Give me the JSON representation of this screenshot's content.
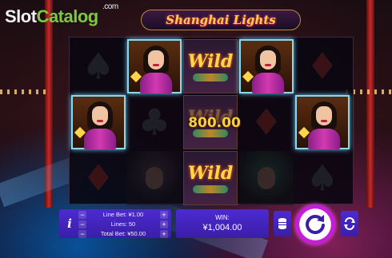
{
  "watermark": {
    "part1": "Slot",
    "part2": "Catalog",
    "suffix": ".com"
  },
  "game": {
    "title": "Shanghai Lights"
  },
  "reels": {
    "wild_label": "Wild",
    "win_on_reel": "800.00",
    "symbols": [
      [
        "spade",
        "lady",
        "diamond"
      ],
      [
        "lady",
        "club",
        "man"
      ],
      [
        "wild",
        "wild",
        "wild"
      ],
      [
        "lady",
        "diamond",
        "woman"
      ],
      [
        "diamond",
        "lady",
        "spade"
      ]
    ]
  },
  "controls": {
    "info_icon": "i",
    "line_bet": "Line Bet: ¥1.00",
    "lines": "Lines: 50",
    "total_bet": "Total Bet: ¥50.00",
    "minus": "−",
    "plus": "+",
    "win_label": "WIN:",
    "win_amount": "¥1,004.00",
    "coins_icon": "coins-icon",
    "spin_icon": "spin-icon",
    "autoplay_icon": "autoplay-icon"
  },
  "colors": {
    "panel": "#4b2bd0",
    "spin_ring": "#c51ed8",
    "highlight": "#8fd6e8",
    "gold": "#ffcf3a"
  }
}
